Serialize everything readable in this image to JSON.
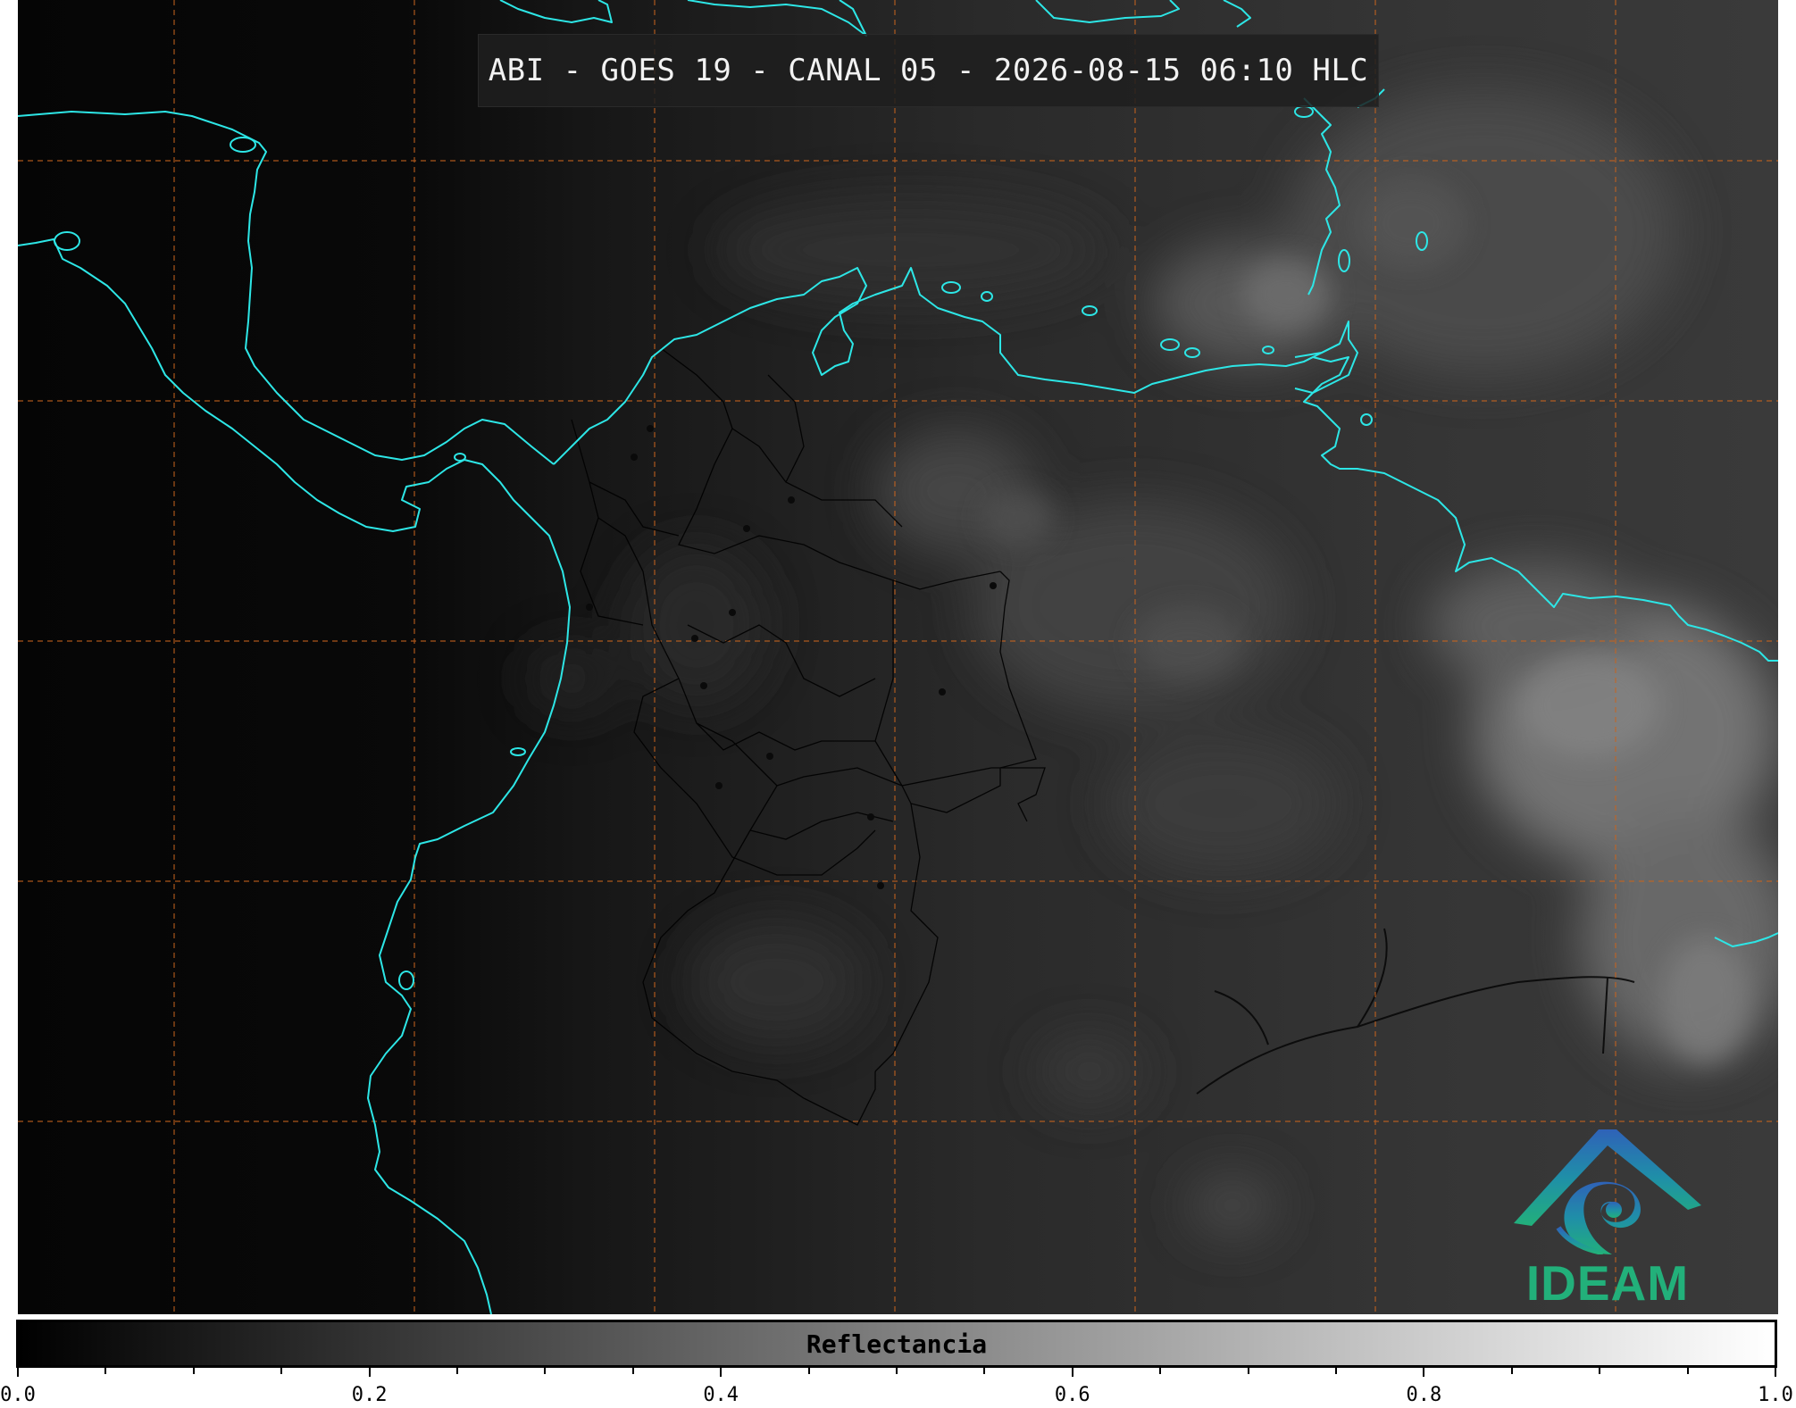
{
  "title": "ABI - GOES 19 - CANAL 05 - 2026-08-15 06:10 HLC",
  "logo": {
    "text": "IDEAM",
    "icon": "ideam-mountain-swirl-logo"
  },
  "colorbar": {
    "label": "Reflectancia",
    "range": [
      0.0,
      1.0
    ],
    "colormap": "grayscale",
    "tick_labels": [
      "0.0",
      "0.2",
      "0.4",
      "0.6",
      "0.8",
      "1.0"
    ],
    "major_ticks": [
      0.0,
      0.2,
      0.4,
      0.6,
      0.8,
      1.0
    ],
    "minor_ticks": [
      0.05,
      0.1,
      0.15,
      0.25,
      0.3,
      0.35,
      0.45,
      0.5,
      0.55,
      0.65,
      0.7,
      0.75,
      0.85,
      0.9,
      0.95
    ]
  },
  "colors": {
    "coastline": "#2de6e6",
    "gridlines": "#c8641e",
    "borders": "#000000",
    "background": "#050505"
  },
  "map_layers": [
    "satellite-reflectance",
    "coastlines",
    "country-borders",
    "department-borders",
    "graticule",
    "city-points"
  ]
}
